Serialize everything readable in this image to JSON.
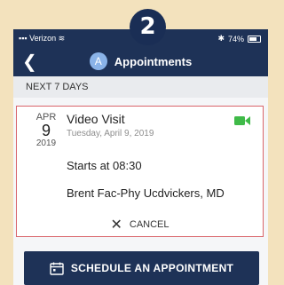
{
  "step": {
    "number": "2"
  },
  "status_bar": {
    "carrier": "Verizon",
    "battery": "74%"
  },
  "nav": {
    "back_icon": "chevron-left-icon",
    "avatar_letter": "A",
    "title": "Appointments"
  },
  "section": {
    "header": "NEXT 7 DAYS"
  },
  "appointment": {
    "month": "APR",
    "day": "9",
    "year": "2019",
    "title": "Video Visit",
    "date_full": "Tuesday, April 9, 2019",
    "starts": "Starts at 08:30",
    "provider": "Brent Fac-Phy Ucdvickers, MD",
    "cancel_label": "CANCEL",
    "video_icon_color": "#3fba48",
    "border_color": "#d9646a"
  },
  "schedule_button": {
    "label": "SCHEDULE AN APPOINTMENT",
    "icon": "calendar-icon"
  },
  "colors": {
    "navy": "#1e3257",
    "background": "#f3e2bd"
  }
}
